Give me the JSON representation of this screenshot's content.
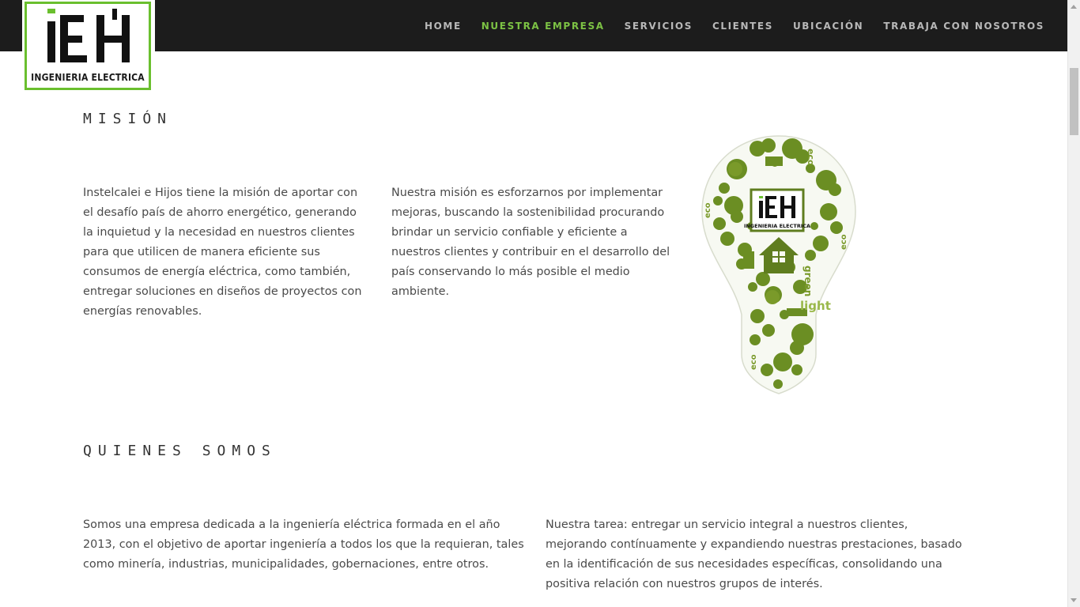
{
  "logo": {
    "mark": "iEH",
    "subtitle": "INGENIERIA ELECTRICA"
  },
  "nav": {
    "items": [
      {
        "label": "HOME",
        "active": false
      },
      {
        "label": "NUESTRA EMPRESA",
        "active": true
      },
      {
        "label": "SERVICIOS",
        "active": false
      },
      {
        "label": "CLIENTES",
        "active": false
      },
      {
        "label": "UBICACIÓN",
        "active": false
      },
      {
        "label": "TRABAJA CON NOSOTROS",
        "active": false
      }
    ]
  },
  "mision": {
    "title": "MISIÓN",
    "paragraph_1": "Instelcalei e Hijos tiene la misión de aportar con el desafío país de ahorro energético, generando la inquietud y la necesidad en nuestros clientes para que utilicen de manera eficiente sus consumos de energía eléctrica, como también, entregar soluciones en diseños de proyectos con energías renovables.",
    "paragraph_2": "Nuestra misión es esforzarnos por implementar mejoras, buscando la sostenibilidad procurando brindar un servicio confiable y eficiente a nuestros clientes y contribuir en el desarrollo del país conservando lo más posible el medio ambiente."
  },
  "bulb_image": {
    "mark": "iEH",
    "subtitle": "INGENIERIA ELECTRICA",
    "words": [
      "eco",
      "eco",
      "eco",
      "eco",
      "green",
      "light"
    ]
  },
  "quienes": {
    "title": "QUIENES SOMOS",
    "paragraph_1": "Somos una empresa dedicada a la ingeniería eléctrica formada en el año 2013, con el objetivo de aportar ingeniería a todos los que la requieran, tales como minería, industrias, municipalidades, gobernaciones, entre otros.",
    "paragraph_2": "Nuestra tarea: entregar un servicio integral a nuestros clientes, mejorando contínuamente y expandiendo nuestras prestaciones, basado en la identificación de sus necesidades específicas, consolidando una positiva relación con nuestros grupos de interés."
  },
  "colors": {
    "header_bg": "#1c1c1c",
    "nav_text": "#b8b8b8",
    "nav_active": "#7cc244",
    "logo_green": "#6abf2e",
    "bulb_green": "#6b8e23"
  }
}
